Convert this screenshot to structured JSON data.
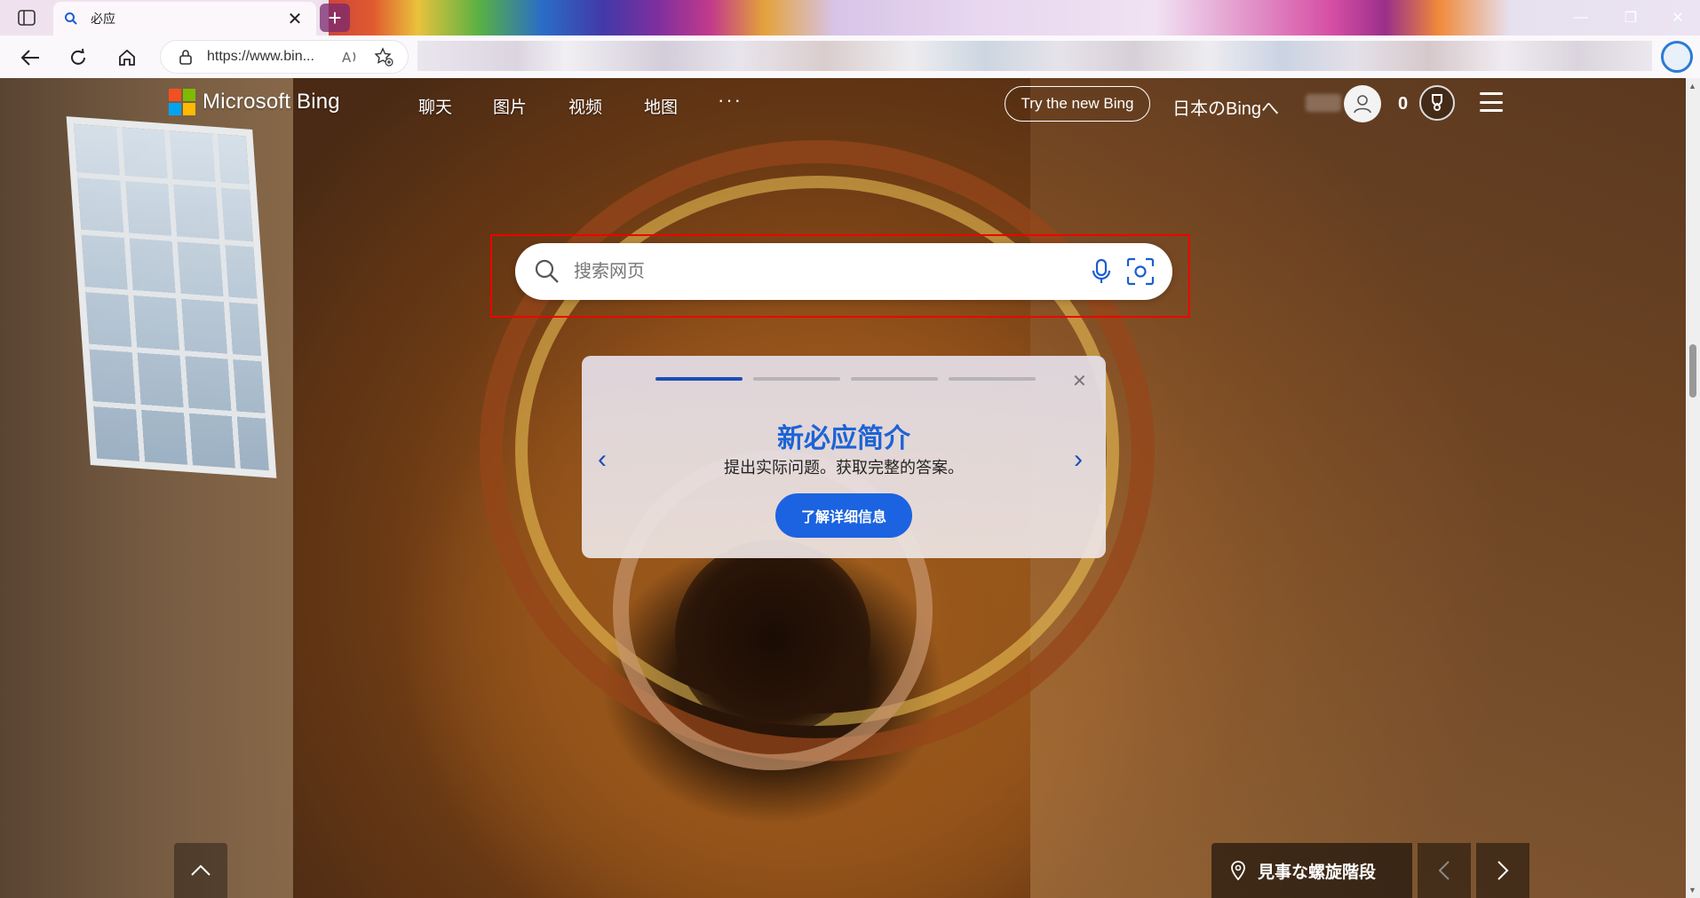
{
  "browser": {
    "tab": {
      "title": "必应",
      "close": "✕"
    },
    "new_tab": "+",
    "address": {
      "url": "https://www.bin..."
    },
    "window_controls": {
      "minimize": "—",
      "restore": "❐",
      "close": "✕"
    }
  },
  "nav": {
    "logo_text": "Microsoft Bing",
    "links": [
      "聊天",
      "图片",
      "视频",
      "地图"
    ],
    "more": "···",
    "try_new_bing": "Try the new Bing",
    "region_link": "日本のBingへ",
    "points": "0"
  },
  "search": {
    "placeholder": "搜索网页",
    "value": ""
  },
  "promo": {
    "title": "新必应简介",
    "subtitle": "提出实际问题。获取完整的答案。",
    "cta": "了解详细信息",
    "close": "✕",
    "prev": "‹",
    "next": "›",
    "slides_total": 4,
    "active_slide": 1
  },
  "image_info": {
    "caption": "見事な螺旋階段"
  },
  "colors": {
    "accent_blue": "#1b63e0",
    "promo_title": "#1c63d6",
    "highlight_red": "#ee0000",
    "logo_red": "#f25022",
    "logo_green": "#7fba00",
    "logo_blue": "#00a4ef",
    "logo_yellow": "#ffb900"
  }
}
